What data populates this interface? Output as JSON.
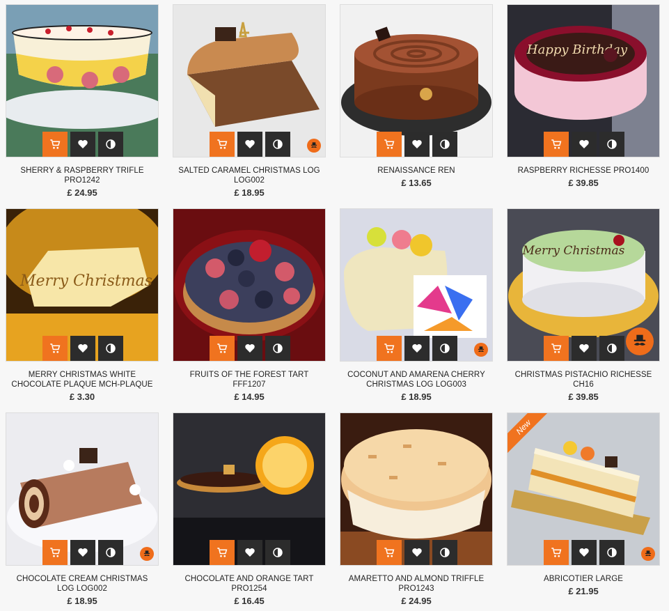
{
  "colors": {
    "accent": "#f0731f",
    "action_bg": "#2c2c2c",
    "page_bg": "#f7f7f7"
  },
  "icons": {
    "cart": "cart-icon",
    "wishlist": "heart-icon",
    "compare": "compare-icon",
    "brand": "moustache-logo-icon"
  },
  "products": [
    {
      "name": "SHERRY & RASPBERRY TRIFLE PRO1242",
      "price": "£ 24.95"
    },
    {
      "name": "SALTED CARAMEL CHRISTMAS LOG LOG002",
      "price": "£ 18.95"
    },
    {
      "name": "RENAISSANCE REN",
      "price": "£ 13.65"
    },
    {
      "name": "RASPBERRY RICHESSE PRO1400",
      "price": "£ 39.85",
      "cake_text": "Happy Birthday"
    },
    {
      "name": "MERRY CHRISTMAS WHITE CHOCOLATE PLAQUE MCH-PLAQUE",
      "price": "£ 3.30",
      "cake_text": "Merry Christmas"
    },
    {
      "name": "FRUITS OF THE FOREST TART FFF1207",
      "price": "£ 14.95"
    },
    {
      "name": "COCONUT AND AMARENA CHERRY CHRISTMAS LOG LOG003",
      "price": "£ 18.95"
    },
    {
      "name": "CHRISTMAS PISTACHIO RICHESSE CH16",
      "price": "£ 39.85",
      "cake_text": "Merry Christmas"
    },
    {
      "name": "CHOCOLATE CREAM CHRISTMAS LOG LOG002",
      "price": "£ 18.95"
    },
    {
      "name": "CHOCOLATE AND ORANGE TART PRO1254",
      "price": "£ 16.45"
    },
    {
      "name": "AMARETTO AND ALMOND TRIFFLE PRO1243",
      "price": "£ 24.95"
    },
    {
      "name": "ABRICOTIER LARGE",
      "price": "£ 21.95",
      "ribbon": "New"
    }
  ]
}
